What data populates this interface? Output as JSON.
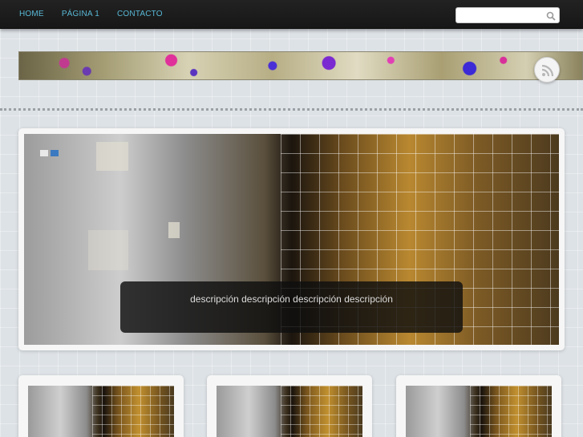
{
  "nav": {
    "items": [
      {
        "label": "HOME"
      },
      {
        "label": "PÁGINA 1"
      },
      {
        "label": "CONTACTO"
      }
    ]
  },
  "search": {
    "value": "",
    "icon": "search-icon"
  },
  "header": {
    "rss_icon": "rss-icon"
  },
  "slider": {
    "caption": "descripción descripción descripción descripción",
    "indicators": [
      "slide-1",
      "slide-2"
    ]
  },
  "posts": [
    {
      "image": "post-thumbnail"
    },
    {
      "image": "post-thumbnail"
    },
    {
      "image": "post-thumbnail"
    }
  ],
  "colors": {
    "nav_link": "#58b8d6",
    "topbar": "#1b1b1b",
    "background": "#dde2e6"
  }
}
